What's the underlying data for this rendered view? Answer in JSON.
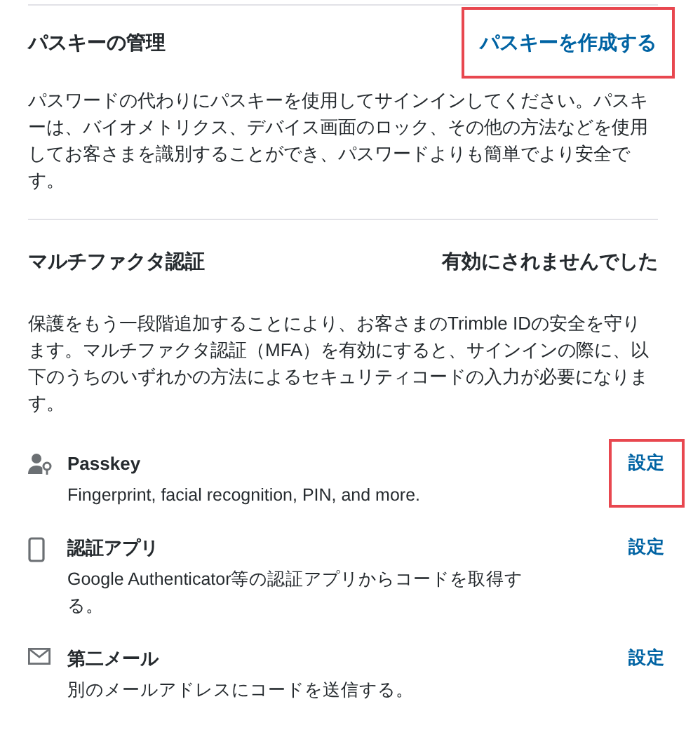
{
  "passkey_section": {
    "title": "パスキーの管理",
    "action": {
      "label": "パスキーを作成する",
      "highlighted": true
    },
    "description": "パスワードの代わりにパスキーを使用してサインインしてください。パスキーは、バイオメトリクス、デバイス画面のロック、その他の方法などを使用してお客さまを識別することができ、パスワードよりも簡単でより安全です。"
  },
  "mfa_section": {
    "title": "マルチファクタ認証",
    "status": "有効にされませんでした",
    "description": "保護をもう一段階追加することにより、お客さまのTrimble IDの安全を守ります。マルチファクタ認証（MFA）を有効にすると、サインインの際に、以下のうちのいずれかの方法によるセキュリティコードの入力が必要になります。",
    "methods": [
      {
        "kind": "passkey",
        "title": "Passkey",
        "description": "Fingerprint, facial recognition, PIN, and more.",
        "action": {
          "label": "設定",
          "highlighted": true
        }
      },
      {
        "kind": "app",
        "title": "認証アプリ",
        "description": "Google Authenticator等の認証アプリからコードを取得する。",
        "action": {
          "label": "設定",
          "highlighted": false
        }
      },
      {
        "kind": "email",
        "title": "第二メール",
        "description": "別のメールアドレスにコードを送信する。",
        "action": {
          "label": "設定",
          "highlighted": false
        }
      }
    ]
  }
}
